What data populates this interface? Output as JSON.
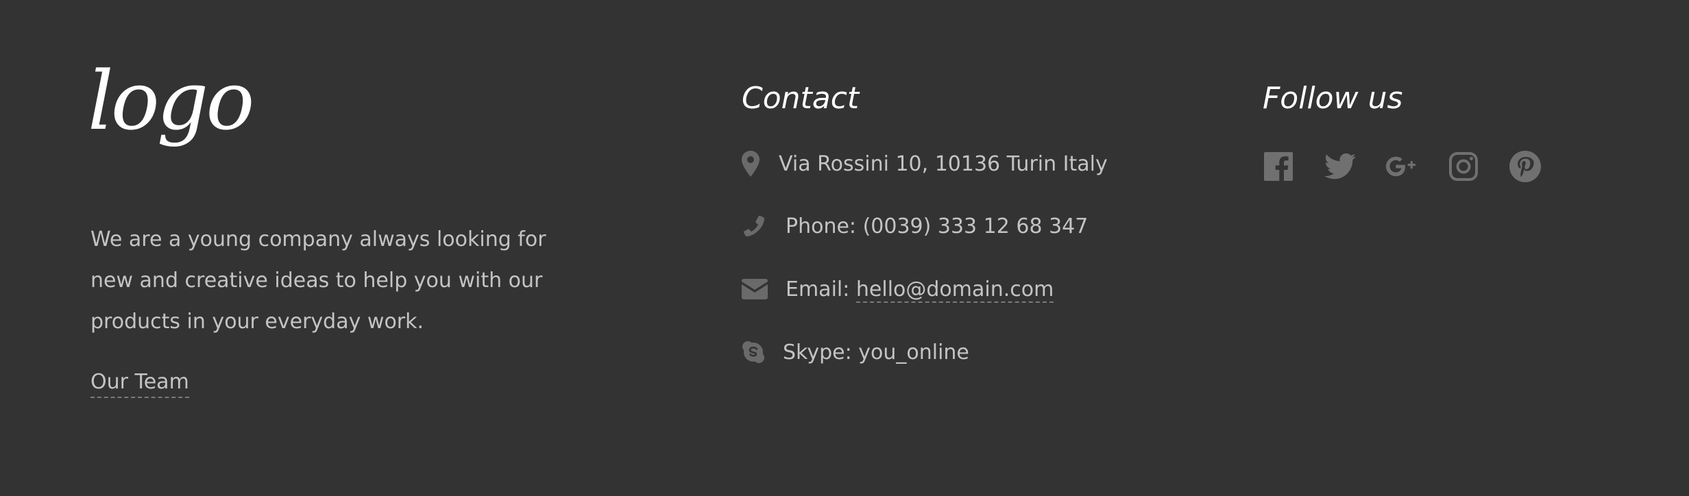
{
  "brand": {
    "logo_text": "logo"
  },
  "about": {
    "text": "We are a young company always looking for new and creative ideas to help you with our products in your everyday work.",
    "team_link": "Our Team"
  },
  "contact": {
    "title": "Contact",
    "address": "Via Rossini 10, 10136 Turin Italy",
    "phone": "Phone: (0039) 333 12 68 347",
    "email_label": "Email: ",
    "email": "hello@domain.com",
    "skype": "Skype: you_online",
    "icons": [
      "map-pin-icon",
      "phone-icon",
      "envelope-icon",
      "skype-icon"
    ]
  },
  "follow": {
    "title": "Follow us",
    "icons": [
      "facebook-icon",
      "twitter-icon",
      "google-plus-icon",
      "instagram-icon",
      "pinterest-icon"
    ]
  },
  "colors": {
    "background": "#333333",
    "text": "#c4c4c4",
    "heading": "#ffffff",
    "icon": "#6a6a6a"
  }
}
